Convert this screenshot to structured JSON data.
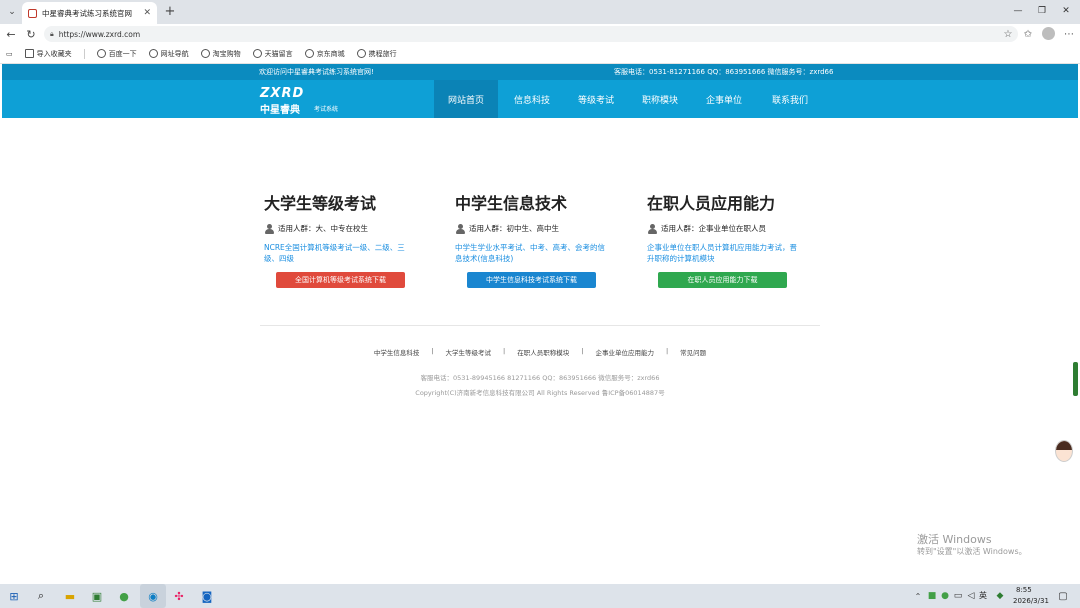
{
  "browser": {
    "tab_title": "中星睿典考试练习系统官网",
    "url": "https://www.zxrd.com",
    "favorites": [
      "导入收藏夹",
      "百度一下",
      "网址导航",
      "淘宝购物",
      "天猫留言",
      "京东商城",
      "携程旅行"
    ]
  },
  "site": {
    "welcome": "欢迎访问中星睿典考试练习系统官网!",
    "contact": "客服电话：0531-81271166   QQ：863951666   微信服务号：zxrd66",
    "logo_en": "ZXRD",
    "logo_cn": "中星睿典",
    "logo_sub": "考试系统",
    "nav": [
      "网站首页",
      "信息科技",
      "等级考试",
      "职称模块",
      "企事单位",
      "联系我们"
    ]
  },
  "columns": [
    {
      "title": "大学生等级考试",
      "audience": "适用人群：大、中专在校生",
      "desc": "NCRE全国计算机等级考试一级、二级、三级、四级",
      "button": "全国计算机等级考试系统下载",
      "color": "#e04a3c"
    },
    {
      "title": "中学生信息技术",
      "audience": "适用人群：初中生、高中生",
      "desc": "中学生学业水平考试、中考、高考、会考的信息技术(信息科技)",
      "button": "中学生信息科技考试系统下载",
      "color": "#1a86d0"
    },
    {
      "title": "在职人员应用能力",
      "audience": "适用人群：企事业单位在职人员",
      "desc": "企事业单位在职人员计算机应用能力考试，晋升职称的计算机模块",
      "button": "在职人员应用能力下载",
      "color": "#2fa84f"
    }
  ],
  "footer": {
    "links": [
      "中学生信息科技",
      "大学生等级考试",
      "在职人员职称模块",
      "企事业单位应用能力",
      "常见问题"
    ],
    "contact": "客服电话：0531-89945166  81271166   QQ：863951666   微信服务号：zxrd66",
    "copyright": "Copyright(C)济南新考信息科技有限公司 All Rights Reserved    鲁ICP备06014887号"
  },
  "watermark": {
    "line1": "激活 Windows",
    "line2": "转到\"设置\"以激活 Windows。"
  },
  "taskbar": {
    "ime": "英",
    "time": "8:55",
    "date": "2026/3/31"
  }
}
